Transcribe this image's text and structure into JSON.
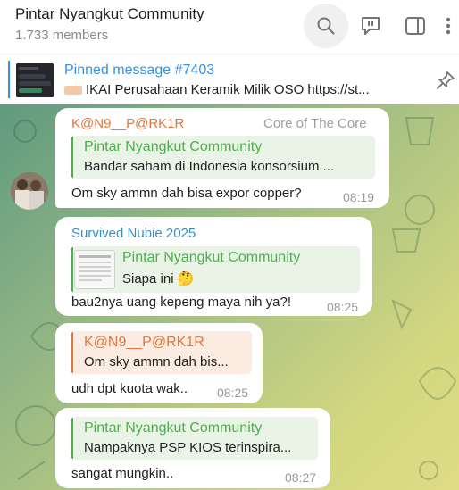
{
  "header": {
    "title": "Pintar Nyangkut Community",
    "members": "1.733 members"
  },
  "pinned": {
    "title": "Pinned message #7403",
    "text": "IKAI Perusahaan Keramik Milik OSO  https://st..."
  },
  "messages": [
    {
      "sender": "K@N9__P@RK1R",
      "rank": "Core of The Core",
      "reply_name": "Pintar Nyangkut Community",
      "reply_text": "Bandar saham di Indonesia konsorsium ...",
      "text": "Om sky ammn dah bisa expor copper?",
      "time": "08:19"
    },
    {
      "sender": "Survived Nubie 2025",
      "reply_name": "Pintar Nyangkut Community",
      "reply_text": "Siapa ini 🤔",
      "text": "bau2nya uang kepeng maya nih ya?!",
      "time": "08:25"
    },
    {
      "reply_name": "K@N9__P@RK1R",
      "reply_text": "Om sky ammn dah bis...",
      "text": "udh dpt kuota wak..",
      "time": "08:25"
    },
    {
      "reply_name": "Pintar Nyangkut Community",
      "reply_text": "Nampaknya PSP KIOS terinspira...",
      "text": "sangat mungkin..",
      "time": "08:27"
    }
  ],
  "colors": {
    "accent": "#3390ec",
    "green_name": "#4fae4e",
    "orange_name": "#e0773e",
    "blue_name": "#3a8fbf"
  },
  "icons": [
    "search-icon",
    "reply-icon",
    "sidebar-icon",
    "more-icon",
    "pin-icon"
  ]
}
